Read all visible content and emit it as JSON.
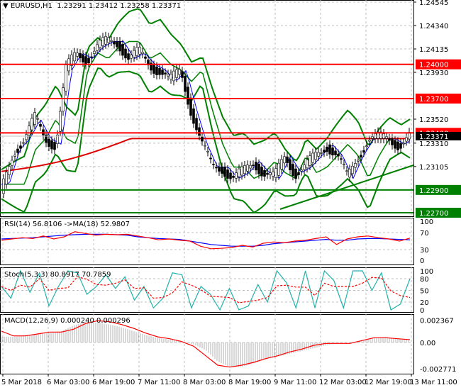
{
  "header": {
    "symbol": "EURUSD,H1",
    "open": "1.23291",
    "high": "1.23412",
    "low": "1.23258",
    "close": "1.23371"
  },
  "price_axis": {
    "ticks": [
      "1.24545",
      "1.24340",
      "1.24135",
      "1.23930",
      "1.23520",
      "1.23310",
      "1.23105"
    ],
    "current": "1.23371"
  },
  "levels": [
    {
      "value": "1.24000",
      "color": "#ff0000"
    },
    {
      "value": "1.23700",
      "color": "#ff0000"
    },
    {
      "value": "1.23400",
      "color": "#ff0000"
    },
    {
      "value": "1.22900",
      "color": "#008000"
    },
    {
      "value": "1.22700",
      "color": "#008000"
    }
  ],
  "rsi": {
    "label": "RSI(14) 56.8106  ->MA(18) 52.9807",
    "ticks": [
      "100",
      "70",
      "30",
      "0"
    ]
  },
  "stoch": {
    "label": "Stoch(5,3,3) 80.8917 70.7859",
    "ticks": [
      "100",
      "80",
      "50",
      "20",
      "0"
    ]
  },
  "macd": {
    "label": "MACD(12,26,9) 0.000240 0.000296",
    "ticks": [
      "0.002367",
      "0.00",
      "-0.002771"
    ]
  },
  "time_axis": [
    "5 Mar 2018",
    "6 Mar 03:00",
    "6 Mar 19:00",
    "7 Mar 11:00",
    "8 Mar 03:00",
    "8 Mar 19:00",
    "9 Mar 11:00",
    "12 Mar 03:00",
    "12 Mar 19:00",
    "13 Mar 11:00"
  ],
  "chart_data": {
    "type": "candlestick",
    "closes": [
      1.2295,
      1.2325,
      1.2335,
      1.2352,
      1.2335,
      1.233,
      1.2395,
      1.241,
      1.2405,
      1.2415,
      1.242,
      1.242,
      1.2405,
      1.241,
      1.24,
      1.2395,
      1.2385,
      1.2395,
      1.236,
      1.233,
      1.231,
      1.231,
      1.23,
      1.2305,
      1.2315,
      1.2305,
      1.23,
      1.232,
      1.2305,
      1.231,
      1.232,
      1.233,
      1.232,
      1.23,
      1.232,
      1.2335,
      1.2335,
      1.2335,
      1.233,
      1.2337
    ],
    "rsi": [
      52,
      55,
      58,
      56,
      62,
      55,
      60,
      72,
      68,
      64,
      66,
      65,
      66,
      62,
      58,
      53,
      55,
      52,
      50,
      38,
      32,
      33,
      35,
      40,
      36,
      45,
      48,
      46,
      50,
      52,
      56,
      60,
      42,
      55,
      60,
      62,
      58,
      55,
      50,
      57
    ],
    "rsi_ma": [
      55,
      56,
      57,
      58,
      60,
      62,
      64,
      65,
      66,
      66,
      66,
      65,
      64,
      60,
      58,
      56,
      55,
      54,
      50,
      46,
      42,
      40,
      38,
      38,
      38,
      40,
      44,
      46,
      48,
      50,
      52,
      54,
      52,
      52,
      55,
      56,
      56,
      55,
      54,
      53
    ],
    "stoch": [
      60,
      30,
      100,
      45,
      95,
      10,
      60,
      100,
      95,
      40,
      60,
      90,
      55,
      85,
      25,
      60,
      5,
      30,
      95,
      90,
      5,
      60,
      40,
      0,
      55,
      0,
      10,
      65,
      20,
      100,
      70,
      5,
      100,
      5,
      100,
      75,
      5,
      100,
      100,
      50,
      95,
      0,
      15,
      80
    ],
    "macd_hist": [
      0.0006,
      0.0006,
      0.0008,
      0.0009,
      0.001,
      0.0012,
      0.0018,
      0.0022,
      0.0021,
      0.0019,
      0.0016,
      0.0012,
      0.0008,
      0.0005,
      0.0003,
      0.0001,
      -0.0002,
      -0.0008,
      -0.002,
      -0.0026,
      -0.0026,
      -0.0022,
      -0.0018,
      -0.0015,
      -0.0012,
      -0.0009,
      -0.0006,
      -0.0003,
      -0.0001,
      0.0,
      0.0002,
      0.0005,
      0.0006,
      0.0004,
      0.0002
    ],
    "macd_signal": [
      0.0012,
      0.0007,
      0.0007,
      0.0009,
      0.0011,
      0.0011,
      0.0014,
      0.002,
      0.0023,
      0.0022,
      0.0019,
      0.0015,
      0.001,
      0.0006,
      0.0004,
      0.0001,
      -0.0004,
      -0.0014,
      -0.0024,
      -0.0026,
      -0.0024,
      -0.0021,
      -0.0017,
      -0.0014,
      -0.001,
      -0.0007,
      -0.0003,
      -0.0001,
      -0.0001,
      -0.0001,
      0.0002,
      0.0005,
      0.0005,
      0.0004,
      0.0003
    ]
  }
}
